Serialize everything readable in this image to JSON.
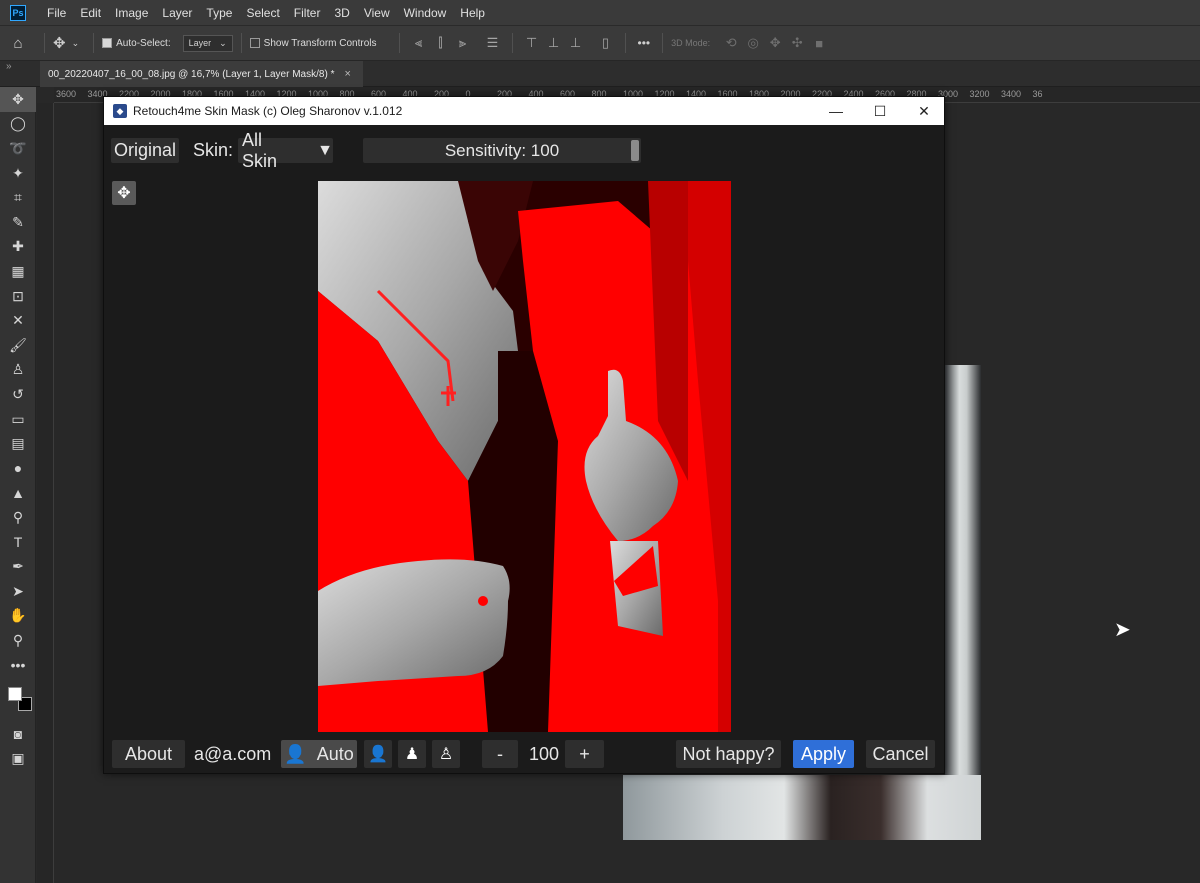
{
  "app": {
    "logo_text": "Ps",
    "menu": [
      "File",
      "Edit",
      "Image",
      "Layer",
      "Type",
      "Select",
      "Filter",
      "3D",
      "View",
      "Window",
      "Help"
    ]
  },
  "options_bar": {
    "auto_select_label": "Auto-Select:",
    "auto_select_checked": true,
    "layer_dropdown": "Layer",
    "show_transform_label": "Show Transform Controls",
    "show_transform_checked": false,
    "mode_3d_label": "3D Mode:",
    "more_label": "•••"
  },
  "document_tab": {
    "title": "00_20220407_16_00_08.jpg @ 16,7% (Layer 1, Layer Mask/8) *",
    "close": "×"
  },
  "ruler": {
    "top_numbers": [
      "3600",
      "3400",
      "2200",
      "2000",
      "1800",
      "1600",
      "1400",
      "1200",
      "1000",
      "800",
      "600",
      "400",
      "200",
      "0",
      "200",
      "400",
      "600",
      "800",
      "1000",
      "1200",
      "1400",
      "1600",
      "1800",
      "2000",
      "2200",
      "2400",
      "2600",
      "2800",
      "3000",
      "3200",
      "3400",
      "36"
    ]
  },
  "plugin": {
    "title": "Retouch4me Skin Mask (c) Oleg Sharonov v.1.012",
    "window_controls": {
      "minimize": "—",
      "maximize": "☐",
      "close": "✕"
    },
    "original_button": "Original",
    "skin_label": "Skin:",
    "skin_dropdown_value": "All Skin",
    "skin_dropdown_arrow": "▼",
    "sensitivity_label": "Sensitivity: 100",
    "sensitivity_value": 1.0,
    "about_button": "About",
    "email": "a@a.com",
    "auto_button": "Auto",
    "minus_button": "-",
    "zoom_value": "100",
    "plus_button": "+",
    "not_happy_button": "Not happy?",
    "apply_button": "Apply",
    "cancel_button": "Cancel"
  },
  "colors": {
    "mask_red": "#ff0000",
    "apply_blue": "#2f6fd8",
    "panel_bg": "#1b1b1b"
  }
}
